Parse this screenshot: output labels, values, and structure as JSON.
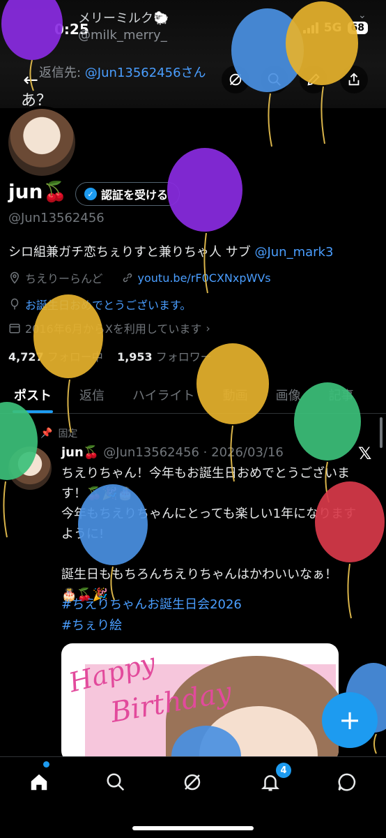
{
  "status_bar": {
    "time": "0:25",
    "network": "5G",
    "battery": "68"
  },
  "header": {
    "name": "メリーミルク🐑",
    "handle": "@milk_merry_",
    "reply_prefix": "返信先: ",
    "reply_to": "@Jun13562456さん",
    "reply_text": "あ？"
  },
  "profile": {
    "name": "jun🍒",
    "verify_label": "認証を受ける",
    "handle": "@Jun13562456",
    "bio_text": "シロ組兼ガチ恋ちぇりすと兼りちゃ人 サブ ",
    "bio_link": "@Jun_mark3",
    "location": "ちえりーらんど",
    "website": "youtu.be/rF0CXNxpWVs",
    "birthday": "お誕生日おめでとうございます。",
    "joined": "2016年6月からXを利用しています",
    "following_count": "4,727",
    "following_label": "フォロー中",
    "followers_count": "1,953",
    "followers_label": "フォロワー"
  },
  "tabs": [
    "ポスト",
    "返信",
    "ハイライト",
    "動画",
    "画像",
    "記事"
  ],
  "post": {
    "pinned_label": "固定",
    "author": "jun🍒",
    "meta": "@Jun13562456 · 2026/03/16",
    "body": "ちえりちゃん！今年もお誕生日おめでとうございます！🍒🎉🎂\n今年もちえりちゃんにとっても楽しい1年になりますように!\n\n誕生日ももちろんちえりちゃんはかわいいなぁ！\n🎂🍒🎉",
    "hashtags": [
      "#ちえりちゃんお誕生日会2026",
      "#ちぇり絵"
    ],
    "image_text_1": "Happy",
    "image_text_2": "Birthday"
  },
  "nav": {
    "notification_count": "4"
  },
  "colors": {
    "accent": "#1d9bf0",
    "link": "#4a9eff",
    "background": "#000000"
  },
  "icons": [
    "back-arrow-icon",
    "grok-icon",
    "search-icon",
    "edit-icon",
    "share-icon",
    "location-icon",
    "link-icon",
    "balloon-icon",
    "calendar-icon",
    "pin-icon",
    "x-logo-icon",
    "plus-icon",
    "home-icon",
    "notifications-icon",
    "messages-icon"
  ]
}
